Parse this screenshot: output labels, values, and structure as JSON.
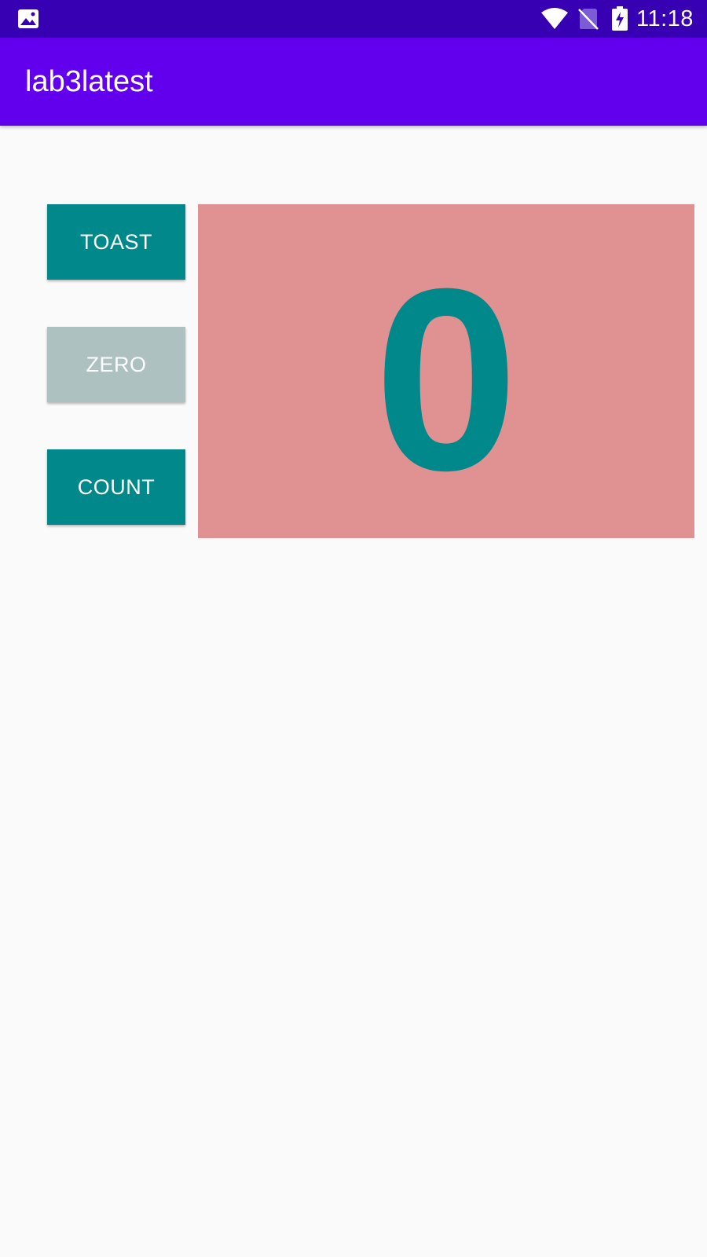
{
  "status_bar": {
    "time": "11:18",
    "icons": [
      "image-notification-icon",
      "wifi-icon",
      "no-sim-icon",
      "battery-charging-icon"
    ],
    "background": "#3700b3"
  },
  "app_bar": {
    "title": "lab3latest",
    "background": "#6200ee"
  },
  "buttons": {
    "toast_label": "TOAST",
    "zero_label": "ZERO",
    "count_label": "COUNT"
  },
  "counter": {
    "value": "0",
    "panel_color": "#e09192",
    "text_color": "#00888a"
  },
  "colors": {
    "button_teal": "#00888a",
    "button_disabled": "#adc1c1",
    "page_background": "#fafafa"
  }
}
